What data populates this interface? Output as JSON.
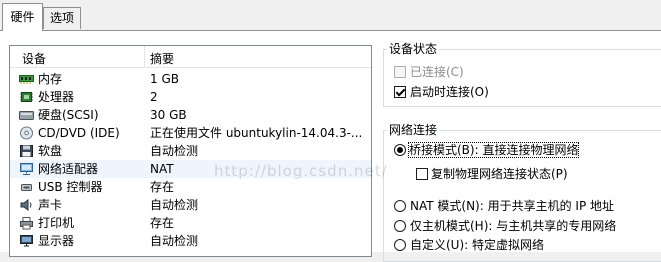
{
  "tabs": [
    {
      "label": "硬件",
      "active": true
    },
    {
      "label": "选项",
      "active": false
    }
  ],
  "device_list": {
    "col_device": "设备",
    "col_summary": "摘要",
    "rows": [
      {
        "name": "内存",
        "summary": "1 GB",
        "icon": "memory-icon"
      },
      {
        "name": "处理器",
        "summary": "2",
        "icon": "processor-icon"
      },
      {
        "name": "硬盘(SCSI)",
        "summary": "30 GB",
        "icon": "hard-disk-icon"
      },
      {
        "name": "CD/DVD (IDE)",
        "summary": "正在使用文件 ubuntukylin-14.04.3-...",
        "icon": "cd-dvd-icon"
      },
      {
        "name": "软盘",
        "summary": "自动检测",
        "icon": "floppy-icon"
      },
      {
        "name": "网络适配器",
        "summary": "NAT",
        "icon": "network-adapter-icon",
        "selected": true
      },
      {
        "name": "USB 控制器",
        "summary": "存在",
        "icon": "usb-icon"
      },
      {
        "name": "声卡",
        "summary": "自动检测",
        "icon": "sound-card-icon"
      },
      {
        "name": "打印机",
        "summary": "存在",
        "icon": "printer-icon"
      },
      {
        "name": "显示器",
        "summary": "自动检测",
        "icon": "display-icon"
      }
    ]
  },
  "device_status": {
    "title": "设备状态",
    "connected": {
      "label": "已连接(C)",
      "checked": false,
      "disabled": true
    },
    "connect_on_power_on": {
      "label": "启动时连接(O)",
      "checked": true
    }
  },
  "network_connection": {
    "title": "网络连接",
    "bridged": {
      "label": "桥接模式(B): 直接连接物理网络",
      "selected": true
    },
    "replicate": {
      "label": "复制物理网络连接状态(P)",
      "checked": false
    },
    "nat": {
      "label": "NAT 模式(N): 用于共享主机的 IP 地址",
      "selected": false
    },
    "host_only": {
      "label": "仅主机模式(H): 与主机共享的专用网络",
      "selected": false
    },
    "custom": {
      "label": "自定义(U): 特定虚拟网络",
      "selected": false
    }
  },
  "watermark": "http://blog.csdn.net/"
}
